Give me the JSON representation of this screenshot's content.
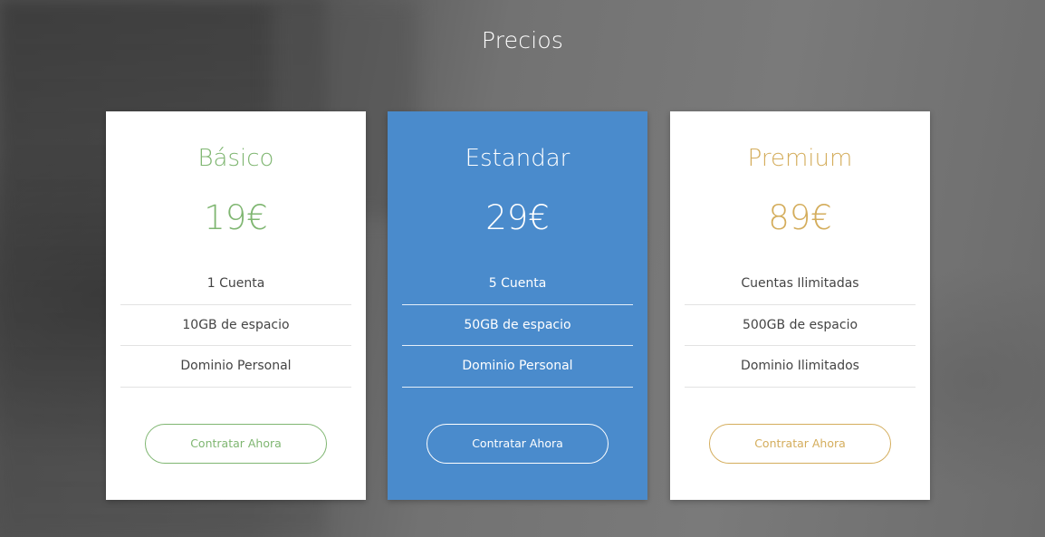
{
  "section": {
    "title": "Precios"
  },
  "colors": {
    "basic_accent": "#7fb671",
    "standard_bg": "#4a8bcc",
    "premium_accent": "#d4ad5c"
  },
  "plans": [
    {
      "name": "Básico",
      "price": "19€",
      "features": [
        "1 Cuenta",
        "10GB de espacio",
        "Dominio Personal"
      ],
      "button": "Contratar Ahora"
    },
    {
      "name": "Estandar",
      "price": "29€",
      "features": [
        "5 Cuenta",
        "50GB de espacio",
        "Dominio Personal"
      ],
      "button": "Contratar Ahora"
    },
    {
      "name": "Premium",
      "price": "89€",
      "features": [
        "Cuentas Ilimitadas",
        "500GB de espacio",
        "Dominio Ilimitados"
      ],
      "button": "Contratar Ahora"
    }
  ]
}
